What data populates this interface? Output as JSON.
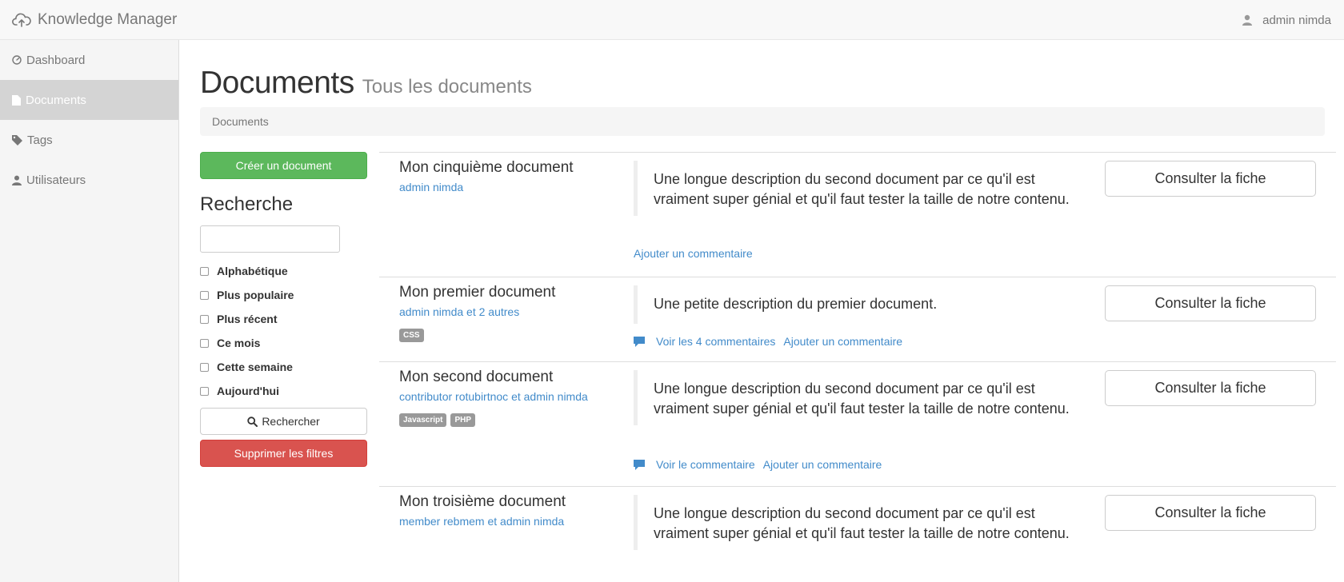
{
  "app": {
    "title": "Knowledge Manager",
    "user": "admin nimda"
  },
  "sidebar": {
    "items": [
      {
        "label": "Dashboard"
      },
      {
        "label": "Documents"
      },
      {
        "label": "Tags"
      },
      {
        "label": "Utilisateurs"
      }
    ]
  },
  "page": {
    "title": "Documents",
    "subtitle": "Tous les documents",
    "breadcrumb": "Documents"
  },
  "search": {
    "create_label": "Créer un document",
    "title": "Recherche",
    "input_value": "",
    "filters": [
      {
        "label": "Alphabétique",
        "checked": false
      },
      {
        "label": "Plus populaire",
        "checked": false
      },
      {
        "label": "Plus récent",
        "checked": false
      },
      {
        "label": "Ce mois",
        "checked": false
      },
      {
        "label": "Cette semaine",
        "checked": false
      },
      {
        "label": "Aujourd'hui",
        "checked": false
      }
    ],
    "search_label": "Rechercher",
    "clear_label": "Supprimer les filtres"
  },
  "documents": [
    {
      "title": "Mon cinquième document",
      "authors": "admin nimda",
      "tags": [],
      "description": "Une longue description du second document par ce qu'il est vraiment super génial et qu'il faut tester la taille de notre contenu.",
      "view_comments": "",
      "add_comment": "Ajouter un commentaire",
      "action": "Consulter la fiche"
    },
    {
      "title": "Mon premier document",
      "authors": "admin nimda et 2 autres",
      "tags": [
        "CSS"
      ],
      "description": "Une petite description du premier document.",
      "view_comments": "Voir les 4 commentaires",
      "add_comment": "Ajouter un commentaire",
      "action": "Consulter la fiche"
    },
    {
      "title": "Mon second document",
      "authors": "contributor rotubirtnoc et admin nimda",
      "tags": [
        "Javascript",
        "PHP"
      ],
      "description": "Une longue description du second document par ce qu'il est vraiment super génial et qu'il faut tester la taille de notre contenu.",
      "view_comments": "Voir le commentaire",
      "add_comment": "Ajouter un commentaire",
      "action": "Consulter la fiche"
    },
    {
      "title": "Mon troisième document",
      "authors": "member rebmem et admin nimda",
      "tags": [],
      "description": "Une longue description du second document par ce qu'il est vraiment super génial et qu'il faut tester la taille de notre contenu.",
      "view_comments": "",
      "add_comment": "",
      "action": "Consulter la fiche"
    }
  ],
  "colors": {
    "primary": "#428bca",
    "success": "#5cb85c",
    "danger": "#d9534f",
    "tag": "#999999"
  }
}
